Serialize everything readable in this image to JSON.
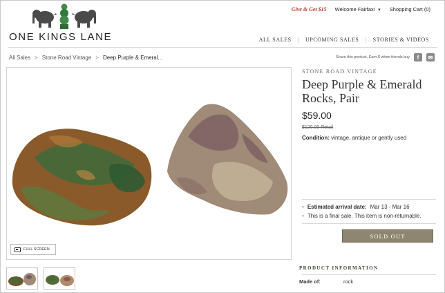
{
  "header": {
    "logo_text": "ONE KINGS LANE",
    "promo": "Give & Get $15",
    "welcome": "Welcome Fairfax!",
    "cart": "Shopping Cart (0)",
    "nav": [
      "ALL SALES",
      "UPCOMING SALES",
      "STORIES & VIDEOS"
    ]
  },
  "breadcrumb": [
    "All Sales",
    "Stone Road Vintage",
    "Deep Purple & Emeral..."
  ],
  "share": {
    "text": "Share this product, Earn $ when friends buy",
    "icons": [
      "facebook-icon",
      "email-icon"
    ]
  },
  "gallery": {
    "fullscreen_label": "FULL SCREEN",
    "thumbnail_count": 2
  },
  "product": {
    "vendor": "STONE ROAD VINTAGE",
    "title": "Deep Purple & Emerald Rocks, Pair",
    "price": "$59.00",
    "retail": "$120.00 Retail",
    "condition_label": "Condition:",
    "condition_value": "vintage, antique or gently used",
    "arrival_label": "Estimated arrival date:",
    "arrival_value": "Mar 13 - Mar 16",
    "final_sale": "This is a final sale. This item is non-returnable.",
    "button": "SOLD OUT"
  },
  "product_information": {
    "heading": "PRODUCT INFORMATION",
    "made_of_label": "Made of:",
    "made_of_value": "rock"
  },
  "colors": {
    "promo": "#c0392b",
    "sold_out_button": "#8e8670",
    "heading_green": "#3e4d2d"
  }
}
